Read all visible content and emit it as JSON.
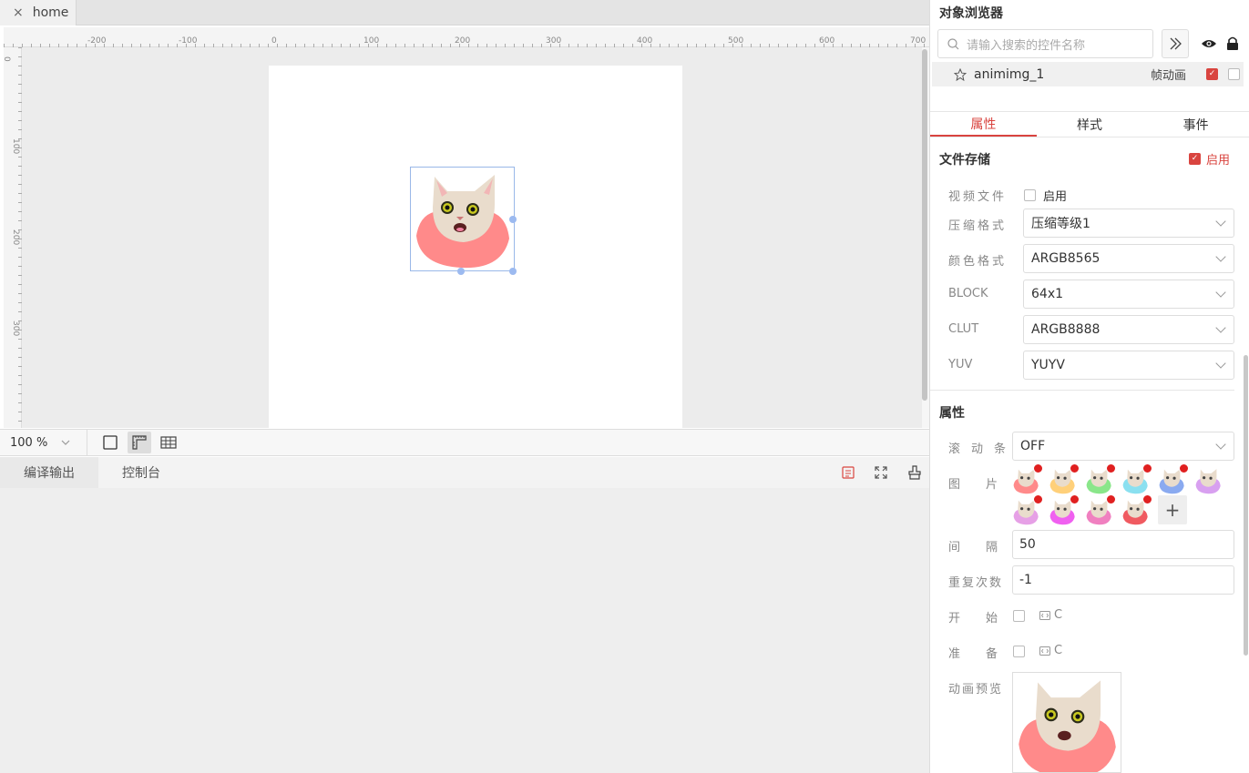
{
  "tabs": [
    {
      "label": "home",
      "close": "×"
    }
  ],
  "ruler": {
    "top_ticks": [
      "-200",
      "-100",
      "0",
      "100",
      "200",
      "300",
      "400",
      "500",
      "600",
      "700"
    ],
    "left_ticks": [
      "0",
      "100",
      "200",
      "300"
    ]
  },
  "zoom": {
    "value": "100 %"
  },
  "bottom": {
    "tabs": [
      "编译输出",
      "控制台"
    ]
  },
  "object_browser": {
    "title": "对象浏览器",
    "search_placeholder": "请输入搜索的控件名称",
    "item": {
      "name": "animimg_1",
      "type": "帧动画"
    }
  },
  "prop_tabs": [
    "属性",
    "样式",
    "事件"
  ],
  "file_storage": {
    "title": "文件存储",
    "enable_label": "启用",
    "video_label": "视频文件",
    "video_enable": "启用",
    "fields": [
      {
        "label": "压缩格式",
        "value": "压缩等级1"
      },
      {
        "label": "颜色格式",
        "value": "ARGB8565"
      },
      {
        "label": "BLOCK",
        "value": "64x1"
      },
      {
        "label": "CLUT",
        "value": "ARGB8888"
      },
      {
        "label": "YUV",
        "value": "YUYV"
      }
    ]
  },
  "properties": {
    "title": "属性",
    "scrollbar_label": "滚动条",
    "scrollbar_value": "OFF",
    "images_label": "图片",
    "interval_label": "间隔",
    "interval_value": "50",
    "repeat_label": "重复次数",
    "repeat_value": "-1",
    "start_label": "开始",
    "start_code": "C",
    "ready_label": "准备",
    "ready_code": "C",
    "preview_label": "动画预览",
    "add_symbol": "+"
  },
  "colors": {
    "accent": "#d9443f",
    "thumb_bg": [
      "#ff8a8a",
      "#ffd07a",
      "#8ae68a",
      "#8ae0f0",
      "#8aaaf0",
      "#d8a0f0",
      "#e6a0e6",
      "#f060f0",
      "#f080c0",
      "#f05a60"
    ]
  }
}
